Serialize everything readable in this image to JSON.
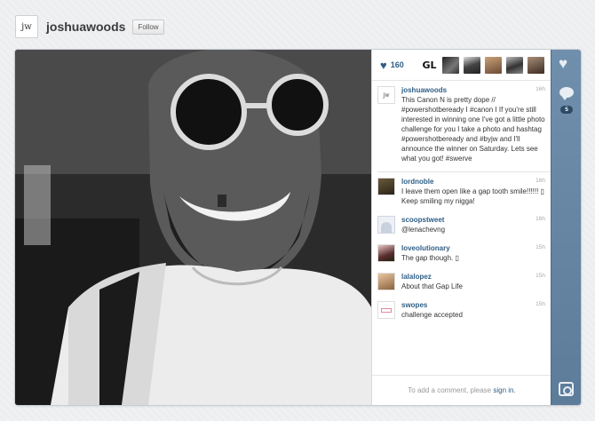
{
  "header": {
    "avatar_text": "jw",
    "username": "joshuawoods",
    "follow_label": "Follow"
  },
  "likes": {
    "count": "160",
    "liker_badge_text": "GL"
  },
  "comments": [
    {
      "user": "joshuawoods",
      "time": "16h",
      "avatar_text": "jw",
      "text": "This Canon N is pretty dope // #powershotbeready I #canon I If you're still interested in winning one I've got a little photo challenge for you I take a photo and hashtag #powershotbeready and #byjw and I'll announce the winner on Saturday. Lets see what you got! #swerve"
    },
    {
      "user": "lordnoble",
      "time": "16h",
      "text": "I leave them open like a gap tooth smile!!!!!! ▯ Keep smiling my nigga!"
    },
    {
      "user": "scoopstweet",
      "time": "16h",
      "text": "@lenachevng"
    },
    {
      "user": "loveolutionary",
      "time": "15h",
      "text": "The gap though. ▯"
    },
    {
      "user": "lalalopez",
      "time": "15h",
      "text": "About that Gap Life"
    },
    {
      "user": "swopes",
      "time": "15h",
      "text": "challenge accepted"
    }
  ],
  "add_comment": {
    "prefix": "To add a comment, please ",
    "link": "sign in."
  },
  "rail": {
    "comment_count": "5"
  },
  "colors": {
    "link_blue": "#2e5e86",
    "rail_blue": "#6f8fad"
  }
}
